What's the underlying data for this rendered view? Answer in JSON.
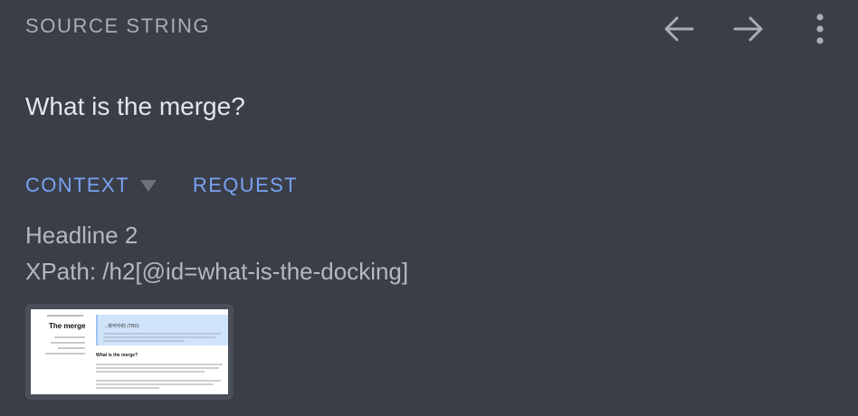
{
  "header": {
    "title": "SOURCE STRING",
    "icons": [
      "arrow-left-icon",
      "arrow-right-icon",
      "more-vertical-icon"
    ]
  },
  "source": {
    "text": "What is the merge?"
  },
  "tabs": [
    {
      "label": "CONTEXT",
      "has_dropdown": true
    },
    {
      "label": "REQUEST",
      "has_dropdown": false
    }
  ],
  "context": {
    "type": "Headline 2",
    "xpath": "XPath: /h2[@id=what-is-the-docking]"
  },
  "thumbnail": {
    "page_title": "The merge",
    "banner_title": "→将可中的 (TBD)",
    "section_heading": "What is the merge?"
  },
  "colors": {
    "background": "#3a3e48",
    "accent": "#7aa2f2",
    "muted_text": "#a9adb4"
  }
}
